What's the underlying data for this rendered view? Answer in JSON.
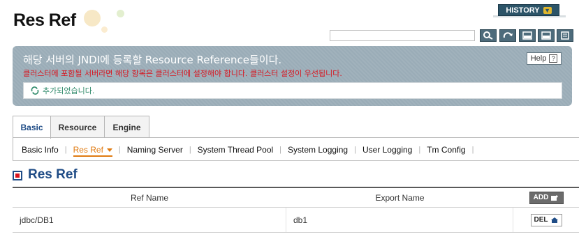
{
  "header": {
    "title": "Res Ref",
    "history_label": "HISTORY",
    "search": {
      "value": "",
      "placeholder": ""
    },
    "toolbar": [
      {
        "name": "search-icon"
      },
      {
        "name": "refresh-icon"
      },
      {
        "name": "xml-export-icon",
        "label": "XML"
      },
      {
        "name": "xml-import-icon",
        "label": "XML"
      },
      {
        "name": "export-icon"
      }
    ]
  },
  "info": {
    "title": "해당 서버의 JNDI에 등록할 Resource Reference들이다.",
    "warning": "클러스터에 포함될 서버라면 해당 항목은 클러스터에 설정해야 합니다. 클러스터 설정이 우선됩니다.",
    "help_label": "Help",
    "message": "추가되었습니다."
  },
  "tabs": [
    {
      "label": "Basic",
      "active": true
    },
    {
      "label": "Resource",
      "active": false
    },
    {
      "label": "Engine",
      "active": false
    }
  ],
  "subnav": [
    {
      "label": "Basic Info",
      "active": false
    },
    {
      "label": "Res Ref",
      "active": true
    },
    {
      "label": "Naming Server",
      "active": false
    },
    {
      "label": "System Thread Pool",
      "active": false
    },
    {
      "label": "System Logging",
      "active": false
    },
    {
      "label": "User Logging",
      "active": false
    },
    {
      "label": "Tm Config",
      "active": false
    }
  ],
  "section": {
    "title": "Res Ref"
  },
  "table": {
    "columns": [
      "Ref Name",
      "Export Name"
    ],
    "add_label": "ADD",
    "del_label": "DEL",
    "rows": [
      {
        "ref_name": "jdbc/DB1",
        "export_name": "db1"
      }
    ]
  },
  "colors": {
    "accent": "#1f4c86",
    "warning": "#d8141e",
    "active_subnav": "#e07a10",
    "panel": "#9aacb7",
    "history": "#2c5468"
  }
}
